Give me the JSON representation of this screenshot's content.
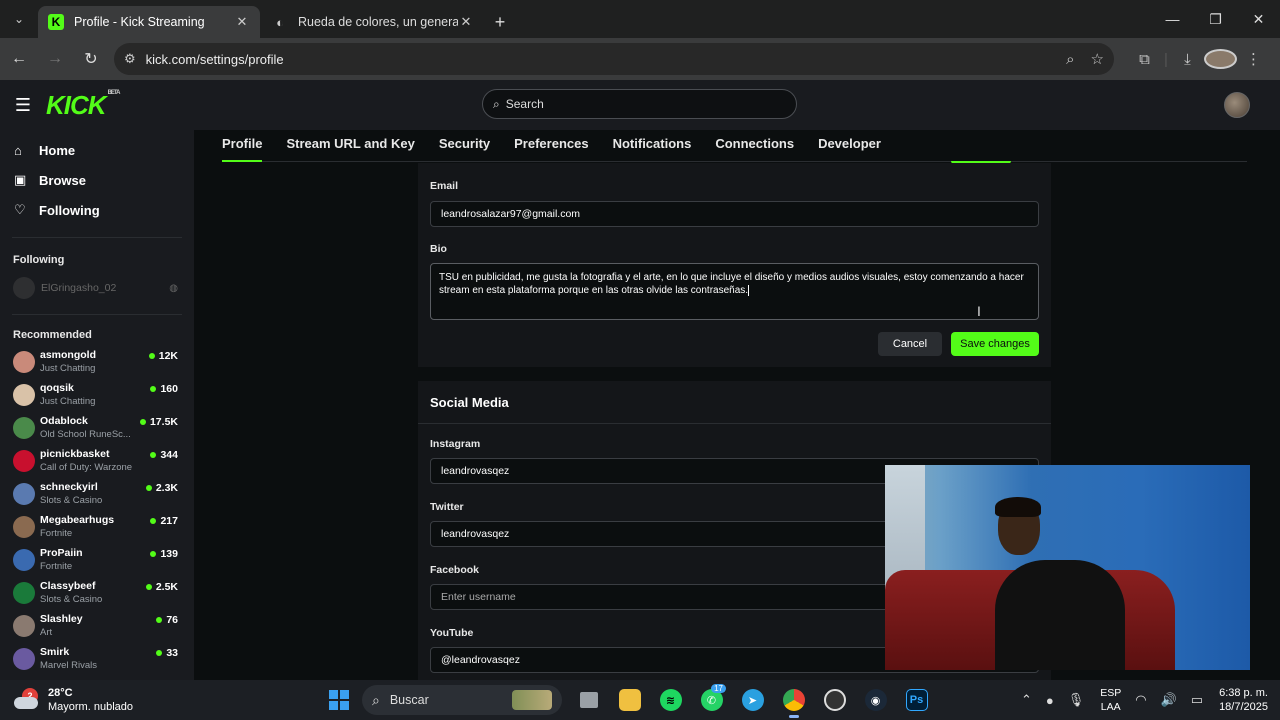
{
  "browser": {
    "tabs": [
      {
        "title": "Profile - Kick Streaming",
        "active": true
      },
      {
        "title": "Rueda de colores, un generador",
        "active": false
      }
    ],
    "url": "kick.com/settings/profile"
  },
  "header": {
    "logo": "KICK",
    "logo_badge": "BETA",
    "search_placeholder": "Search"
  },
  "sidebar": {
    "nav": [
      {
        "label": "Home",
        "icon": "home-icon"
      },
      {
        "label": "Browse",
        "icon": "browse-icon"
      },
      {
        "label": "Following",
        "icon": "heart-icon"
      }
    ],
    "following_title": "Following",
    "following": [
      {
        "name": "ElGringasho_02"
      }
    ],
    "recommended_title": "Recommended",
    "recommended": [
      {
        "name": "asmongold",
        "category": "Just Chatting",
        "viewers": "12K",
        "color": "#c98a7a"
      },
      {
        "name": "qoqsik",
        "category": "Just Chatting",
        "viewers": "160",
        "color": "#d9c2a8"
      },
      {
        "name": "Odablock",
        "category": "Old School RuneSc...",
        "viewers": "17.5K",
        "color": "#4a8a4a"
      },
      {
        "name": "picnickbasket",
        "category": "Call of Duty: Warzone",
        "viewers": "344",
        "color": "#c8102e"
      },
      {
        "name": "schneckyirl",
        "category": "Slots & Casino",
        "viewers": "2.3K",
        "color": "#5a7ab0"
      },
      {
        "name": "Megabearhugs",
        "category": "Fortnite",
        "viewers": "217",
        "color": "#8a6a50"
      },
      {
        "name": "ProPaiin",
        "category": "Fortnite",
        "viewers": "139",
        "color": "#3a6ab0"
      },
      {
        "name": "Classybeef",
        "category": "Slots & Casino",
        "viewers": "2.5K",
        "color": "#1a7a3a"
      },
      {
        "name": "Slashley",
        "category": "Art",
        "viewers": "76",
        "color": "#8a7a70"
      },
      {
        "name": "Smirk",
        "category": "Marvel Rivals",
        "viewers": "33",
        "color": "#6a5aa0"
      }
    ]
  },
  "settings_tabs": [
    "Profile",
    "Stream URL and Key",
    "Security",
    "Preferences",
    "Notifications",
    "Connections",
    "Developer"
  ],
  "profile": {
    "email_label": "Email",
    "email_value": "leandrosalazar97@gmail.com",
    "bio_label": "Bio",
    "bio_value": "TSU en publicidad, me gusta la fotografia y el arte, en lo que incluye el diseño y medios audios visuales, estoy comenzando a hacer stream en esta plataforma porque en las otras olvide las contraseñas.",
    "cancel_label": "Cancel",
    "save_label": "Save changes"
  },
  "social": {
    "title": "Social Media",
    "instagram_label": "Instagram",
    "instagram_value": "leandrovasqez",
    "twitter_label": "Twitter",
    "twitter_value": "leandrovasqez",
    "facebook_label": "Facebook",
    "facebook_placeholder": "Enter username",
    "youtube_label": "YouTube",
    "youtube_value": "@leandrovasqez"
  },
  "taskbar": {
    "temperature": "28°C",
    "weather": "Mayorm. nublado",
    "weather_badge": "2",
    "search_label": "Buscar",
    "whatsapp_badge": "17",
    "lang_top": "ESP",
    "lang_bottom": "LAA",
    "time": "6:38 p. m.",
    "date": "18/7/2025"
  },
  "colors": {
    "accent": "#53fc18",
    "bg": "#0b0e0f",
    "panel": "#141619",
    "sidebar": "#191b1f"
  }
}
